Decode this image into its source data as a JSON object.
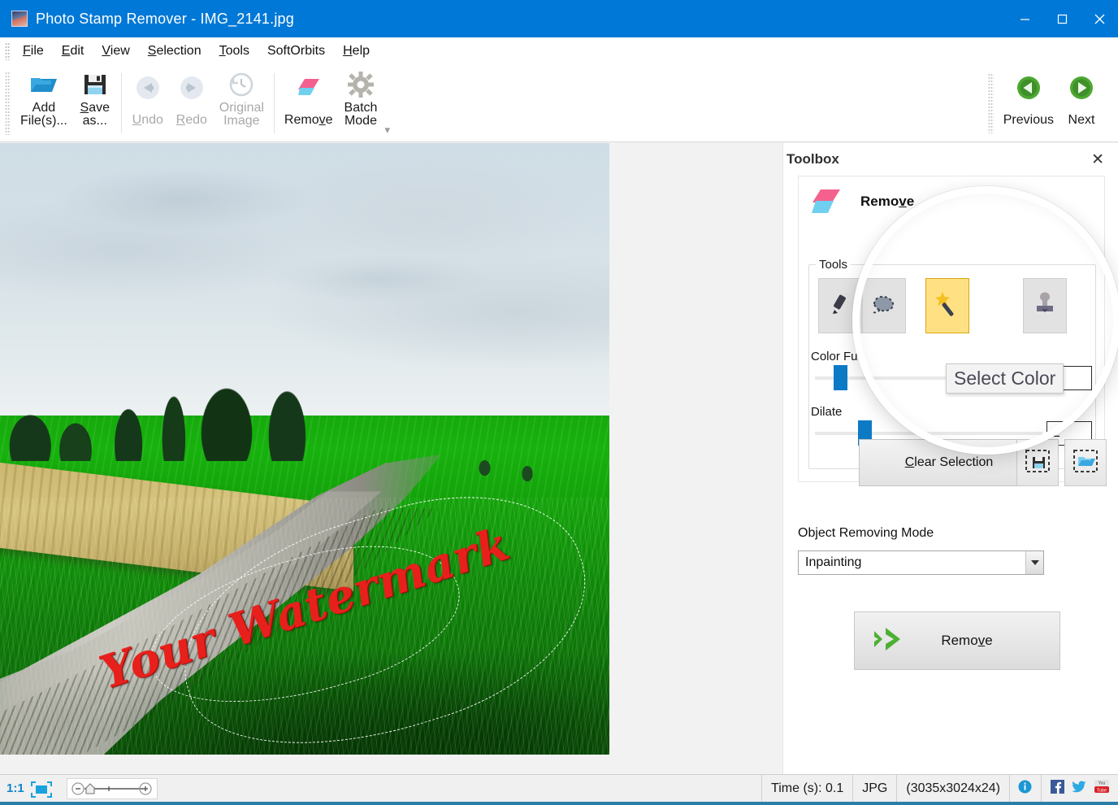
{
  "window": {
    "title": "Photo Stamp Remover - IMG_2141.jpg",
    "app_icon": "app-photo-icon",
    "minimize_label": "Minimize",
    "maximize_label": "Maximize",
    "close_label": "Close",
    "accent_color": "#0078d7"
  },
  "menu": {
    "items": [
      {
        "label": "File",
        "accel": "F"
      },
      {
        "label": "Edit",
        "accel": "E"
      },
      {
        "label": "View",
        "accel": "V"
      },
      {
        "label": "Selection",
        "accel": "S"
      },
      {
        "label": "Tools",
        "accel": "T"
      },
      {
        "label": "SoftOrbits",
        "accel": ""
      },
      {
        "label": "Help",
        "accel": "H"
      }
    ]
  },
  "ribbon": {
    "add_files": "Add\nFile(s)...",
    "save_as": "Save\nas...",
    "undo": "Undo",
    "redo": "Redo",
    "original_image": "Original\nImage",
    "remove": "Remove",
    "batch_mode": "Batch\nMode",
    "previous": "Previous",
    "next": "Next",
    "expander": "▾"
  },
  "toolbox": {
    "panel_title": "Toolbox",
    "close_label": "✕",
    "section_title": "Remove",
    "tools_legend": "Tools",
    "tools": [
      {
        "name": "marker-tool",
        "selected": false
      },
      {
        "name": "lasso-tool",
        "selected": false
      },
      {
        "name": "magic-wand-tool",
        "selected": true
      },
      {
        "name": "stamp-tool",
        "selected": false
      }
    ],
    "color_fuzz_label": "Color Fuz",
    "color_fuzz_value": "0",
    "dilate_label": "Dilate",
    "dilate_value": "2",
    "clear_selection": "Clear Selection",
    "save_selection_icon": "save-selection-icon",
    "load_selection_icon": "load-selection-icon",
    "select_color_tooltip": "Select Color",
    "object_removing_mode_label": "Object Removing Mode",
    "object_removing_mode_value": "Inpainting",
    "remove_button": "Remove"
  },
  "image": {
    "watermark_text": "Your Watermark",
    "watermark_color": "#e8201c"
  },
  "statusbar": {
    "zoom_ratio": "1:1",
    "fit_icon": "fit-to-screen-icon",
    "zoom_out_icon": "zoom-out-icon",
    "zoom_in_icon": "zoom-in-icon",
    "time_label": "Time (s): 0.1",
    "format": "JPG",
    "dimensions": "(3035x3024x24)",
    "info_icon": "info-icon",
    "facebook_icon": "facebook-icon",
    "twitter_icon": "twitter-icon",
    "youtube_icon": "youtube-icon"
  }
}
